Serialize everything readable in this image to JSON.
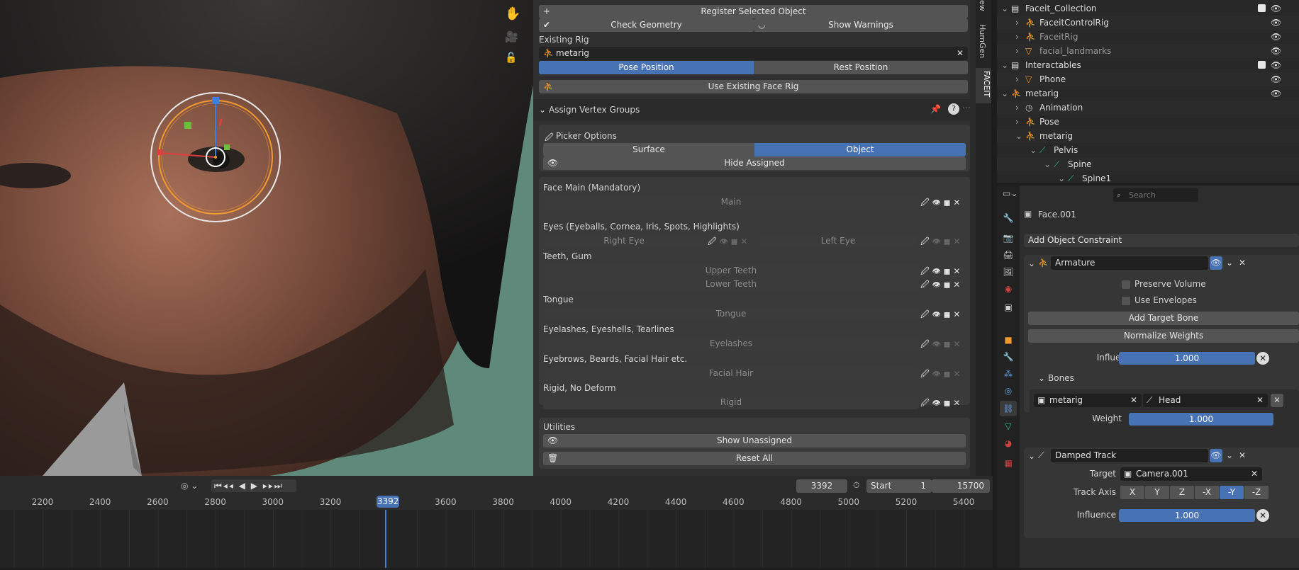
{
  "viewport": {
    "nav_icons": [
      "hand-icon",
      "camera-icon",
      "lock-icon"
    ]
  },
  "npanel": {
    "register_selected": "Register Selected Object",
    "check_geometry": "Check Geometry",
    "show_warnings": "Show Warnings",
    "existing_rig_label": "Existing Rig",
    "rig_name": "metarig",
    "pose_position": "Pose Position",
    "rest_position": "Rest Position",
    "use_existing": "Use Existing Face Rig",
    "assign_title": "Assign Vertex Groups",
    "picker_options": "Picker Options",
    "surface": "Surface",
    "object": "Object",
    "hide_assigned": "Hide Assigned",
    "groups": {
      "face_main": "Face Main (Mandatory)",
      "main": "Main",
      "eyes": "Eyes (Eyeballs, Cornea, Iris, Spots, Highlights)",
      "right_eye": "Right Eye",
      "left_eye": "Left Eye",
      "teeth": "Teeth, Gum",
      "upper_teeth": "Upper Teeth",
      "lower_teeth": "Lower Teeth",
      "tongue_title": "Tongue",
      "tongue": "Tongue",
      "eyelashes_title": "Eyelashes, Eyeshells, Tearlines",
      "eyelashes": "Eyelashes",
      "facial_title": "Eyebrows, Beards, Facial Hair etc.",
      "facial_hair": "Facial Hair",
      "rigid_title": "Rigid, No Deform",
      "rigid": "Rigid"
    },
    "utilities": "Utilities",
    "show_unassigned": "Show Unassigned",
    "reset_all": "Reset All"
  },
  "vtabs": [
    "ew",
    "HumGen",
    "FACEIT"
  ],
  "timeline": {
    "current_frame": "3392",
    "start_label": "Start",
    "start": "1",
    "end": "15700",
    "ticks": [
      "2200",
      "2400",
      "2600",
      "2800",
      "3000",
      "3200",
      "3392",
      "3600",
      "3800",
      "4000",
      "4200",
      "4400",
      "4600",
      "4800",
      "5000",
      "5200",
      "5400"
    ]
  },
  "outliner": {
    "rows": [
      {
        "name": "Faceit_Collection",
        "type": "collection",
        "depth": 0
      },
      {
        "name": "FaceitControlRig",
        "type": "armature",
        "depth": 1
      },
      {
        "name": "FaceitRig",
        "type": "armature",
        "depth": 1
      },
      {
        "name": "facial_landmarks",
        "type": "mesh",
        "depth": 1
      },
      {
        "name": "Interactables",
        "type": "collection",
        "depth": 0
      },
      {
        "name": "Phone",
        "type": "mesh",
        "depth": 1
      },
      {
        "name": "metarig",
        "type": "armature",
        "depth": 0
      },
      {
        "name": "Animation",
        "type": "anim",
        "depth": 1
      },
      {
        "name": "Pose",
        "type": "pose",
        "depth": 1
      },
      {
        "name": "metarig",
        "type": "armdata",
        "depth": 1
      },
      {
        "name": "Pelvis",
        "type": "bone",
        "depth": 2
      },
      {
        "name": "Spine",
        "type": "bone",
        "depth": 3
      },
      {
        "name": "Spine1",
        "type": "bone",
        "depth": 4
      }
    ]
  },
  "props": {
    "search_placeholder": "Search",
    "object_name": "Face.001",
    "add_constraint": "Add Object Constraint",
    "armature": {
      "name": "Armature",
      "preserve_volume": "Preserve Volume",
      "use_envelopes": "Use Envelopes",
      "add_target_bone": "Add Target Bone",
      "normalize_weights": "Normalize Weights",
      "influence_label": "Influence",
      "influence": "1.000",
      "bones_label": "Bones",
      "target": "metarig",
      "bone": "Head",
      "weight_label": "Weight",
      "weight": "1.000"
    },
    "damped": {
      "name": "Damped Track",
      "target_label": "Target",
      "target": "Camera.001",
      "track_axis_label": "Track Axis",
      "axes": [
        "X",
        "Y",
        "Z",
        "-X",
        "-Y",
        "-Z"
      ],
      "active_axis": "-Y",
      "influence_label": "Influence",
      "influence": "1.000"
    }
  },
  "colors": {
    "accent": "#4772b3",
    "selection_orange": "#f29a2e",
    "bone_green": "#2fbf9b",
    "timeline_cursor": "#4a7fd6"
  }
}
